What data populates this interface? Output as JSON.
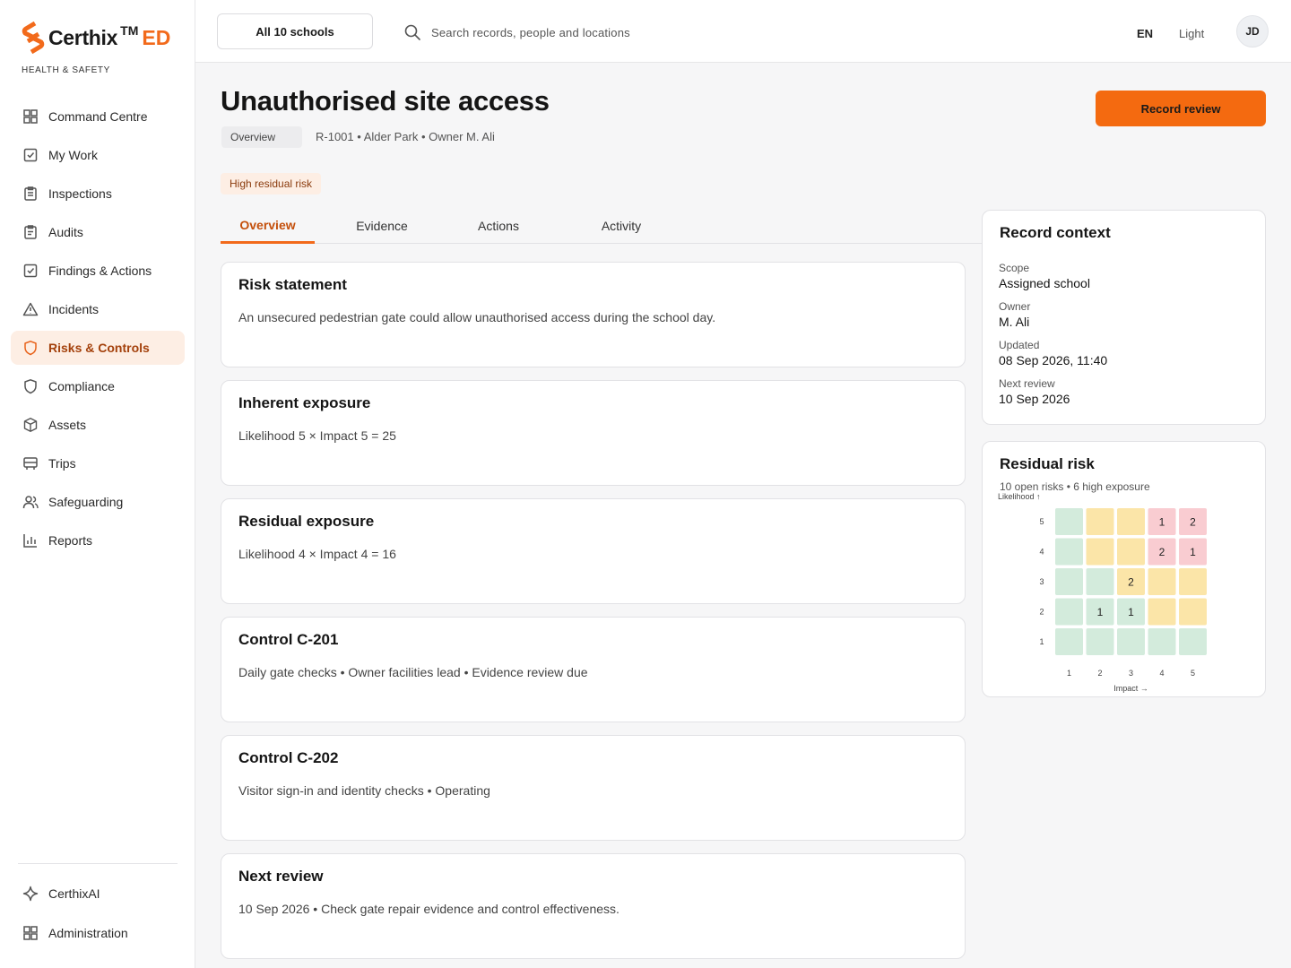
{
  "brand": {
    "name": "Certhix",
    "tm": "TM",
    "suffix": "ED",
    "subtitle": "HEALTH & SAFETY",
    "accent": "#f26a1b"
  },
  "sidebar": {
    "items": [
      {
        "label": "Command Centre",
        "icon": "grid-icon"
      },
      {
        "label": "My Work",
        "icon": "check-square-icon"
      },
      {
        "label": "Inspections",
        "icon": "clipboard-icon"
      },
      {
        "label": "Audits",
        "icon": "clipboard-list-icon"
      },
      {
        "label": "Findings & Actions",
        "icon": "check-square-icon"
      },
      {
        "label": "Incidents",
        "icon": "warning-icon"
      },
      {
        "label": "Risks & Controls",
        "icon": "shield-icon",
        "active": true
      },
      {
        "label": "Compliance",
        "icon": "shield-icon"
      },
      {
        "label": "Assets",
        "icon": "box-icon"
      },
      {
        "label": "Trips",
        "icon": "bus-icon"
      },
      {
        "label": "Safeguarding",
        "icon": "users-icon"
      },
      {
        "label": "Reports",
        "icon": "bar-chart-icon"
      }
    ],
    "bottom": [
      {
        "label": "CerthixAI",
        "icon": "sparkle-icon"
      },
      {
        "label": "Administration",
        "icon": "grid-icon"
      }
    ]
  },
  "topbar": {
    "school_select": "All 10 schools",
    "search_placeholder": "Search records, people and locations",
    "language": "EN",
    "theme": "Light",
    "avatar_initials": "JD"
  },
  "page": {
    "title": "Unauthorised site access",
    "breadcrumb_pill": "Overview",
    "meta": "R-1001 • Alder Park • Owner M. Ali",
    "badge": "High residual risk",
    "primary_action": "Record review"
  },
  "tabs": [
    "Overview",
    "Evidence",
    "Actions",
    "Activity"
  ],
  "active_tab": 0,
  "cards": [
    {
      "title": "Risk statement",
      "body": "An unsecured pedestrian gate could allow unauthorised access during the school day."
    },
    {
      "title": "Inherent exposure",
      "body": "Likelihood 5 × Impact 5 = 25"
    },
    {
      "title": "Residual exposure",
      "body": "Likelihood 4 × Impact 4 = 16"
    },
    {
      "title": "Control C-201",
      "body": "Daily gate checks • Owner facilities lead • Evidence review due"
    },
    {
      "title": "Control C-202",
      "body": "Visitor sign-in and identity checks • Operating"
    },
    {
      "title": "Next review",
      "body": "10 Sep 2026 • Check gate repair evidence and control effectiveness."
    }
  ],
  "context": {
    "title": "Record context",
    "fields": [
      {
        "label": "Scope",
        "value": "Assigned school"
      },
      {
        "label": "Owner",
        "value": "M. Ali"
      },
      {
        "label": "Updated",
        "value": "08 Sep 2026, 11:40"
      },
      {
        "label": "Next review",
        "value": "10 Sep 2026"
      }
    ]
  },
  "residual": {
    "title": "Residual risk",
    "summary": "10 open risks • 6 high exposure"
  },
  "chart_data": {
    "type": "heatmap",
    "ylabel": "Likelihood ↑",
    "xlabel": "Impact →",
    "x": [
      1,
      2,
      3,
      4,
      5
    ],
    "y": [
      5,
      4,
      3,
      2,
      1
    ],
    "cells": [
      [
        null,
        null,
        null,
        1,
        2
      ],
      [
        null,
        null,
        null,
        2,
        1
      ],
      [
        null,
        null,
        2,
        null,
        null
      ],
      [
        null,
        1,
        1,
        null,
        null
      ],
      [
        null,
        null,
        null,
        null,
        null
      ]
    ],
    "bands": [
      [
        "low",
        "medium",
        "medium",
        "high",
        "high"
      ],
      [
        "low",
        "medium",
        "medium",
        "high",
        "high"
      ],
      [
        "low",
        "low",
        "medium",
        "medium",
        "medium"
      ],
      [
        "low",
        "low",
        "low",
        "medium",
        "medium"
      ],
      [
        "low",
        "low",
        "low",
        "low",
        "low"
      ]
    ],
    "colors": {
      "low": "#d3ebdc",
      "medium": "#fbe5a8",
      "high": "#f9ccd1"
    }
  }
}
